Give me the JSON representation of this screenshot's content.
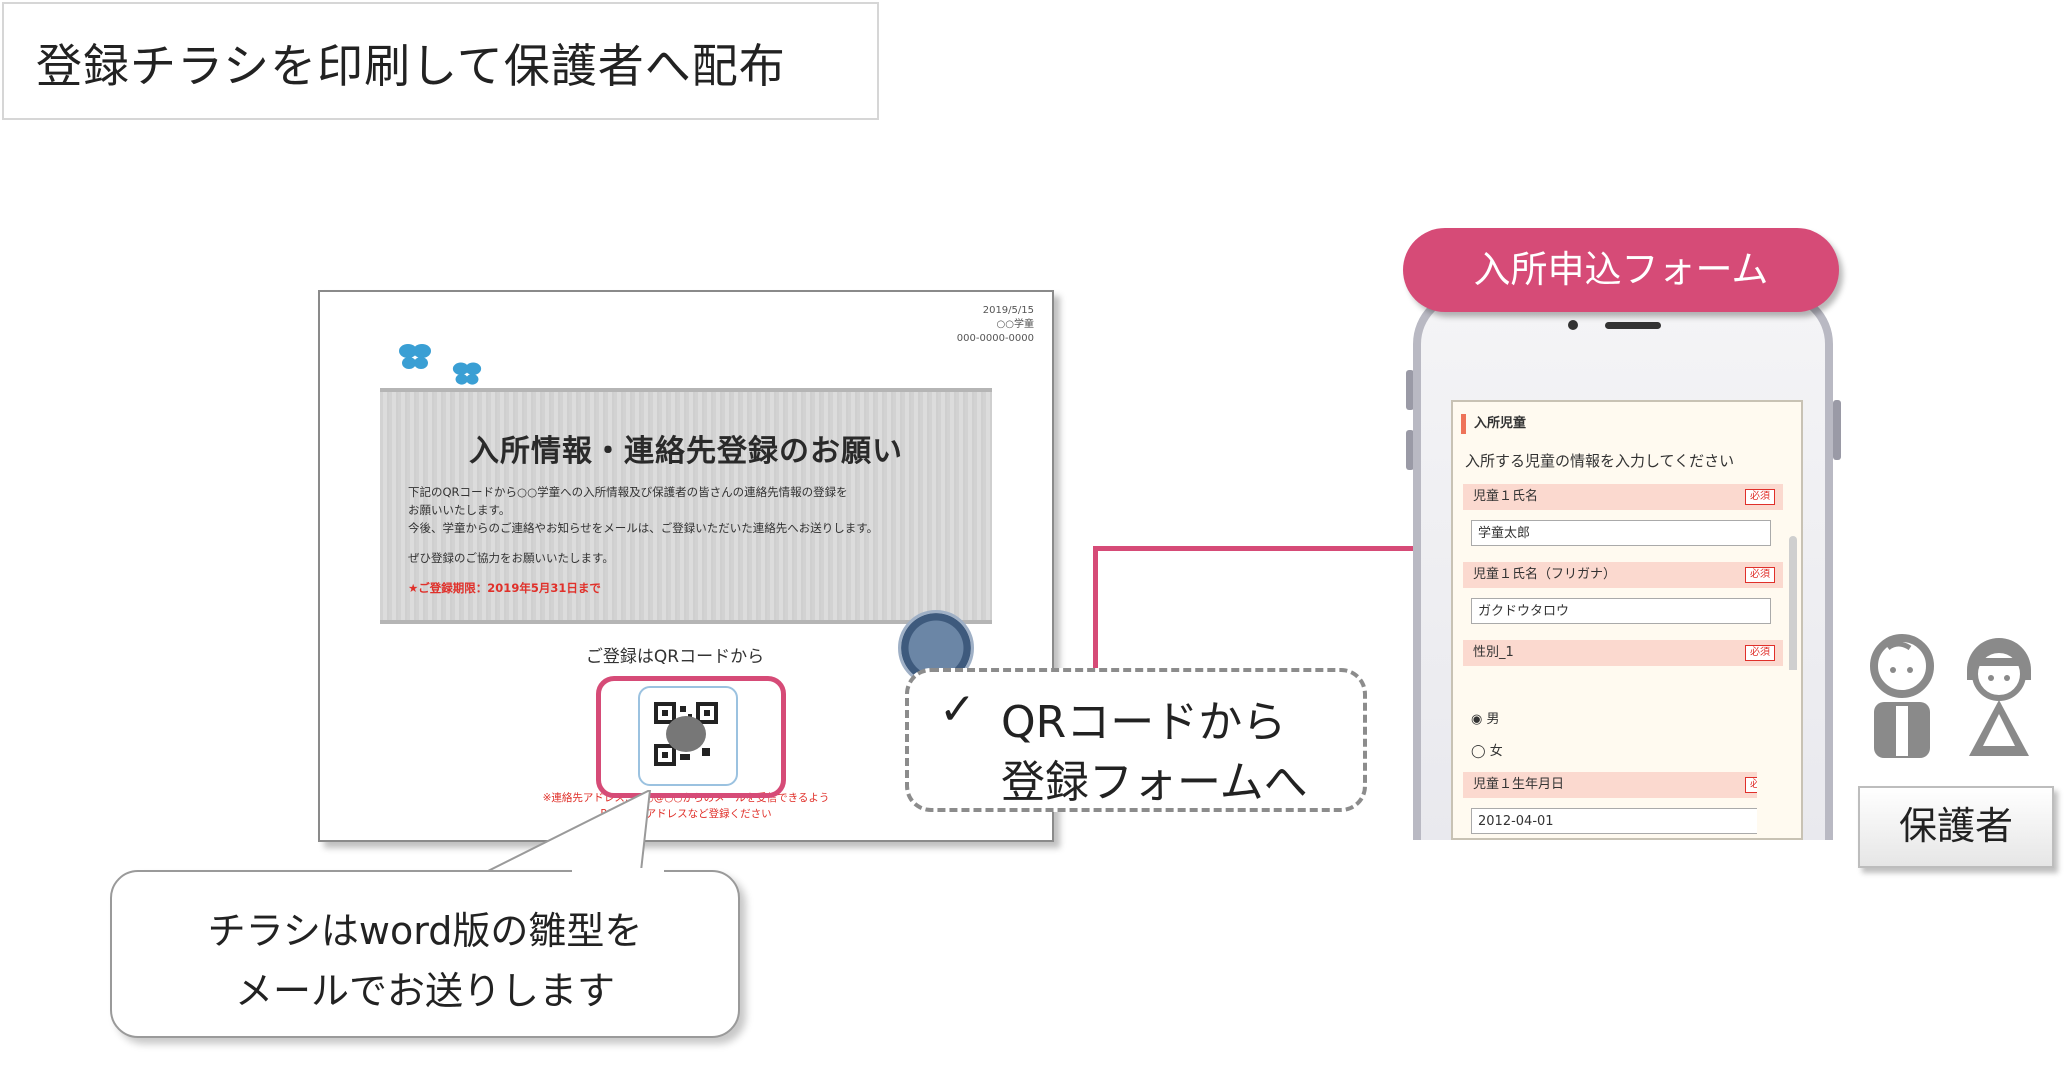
{
  "title": "登録チラシを印刷して保護者へ配布",
  "flyer": {
    "meta_lines": [
      "2019/5/15",
      "○○学童",
      "000-0000-0000"
    ],
    "heading": "入所情報・連絡先登録のお願い",
    "body_lines": [
      "下記のQRコードから○○学童への入所情報及び保護者の皆さんの連絡先情報の登録を",
      "お願いいたします。",
      "今後、学童からのご連絡やお知らせをメールは、ご登録いただいた連絡先へお送りします。",
      "ぜひ登録のご協力をお願いいたします。"
    ],
    "deadline": "★ご登録期限：2019年5月31日まで",
    "qr_caption": "ご登録はQRコードから",
    "note_lines": [
      "※連絡先アドレス…○○@○○からのメールを受信できるよう",
      "PCメールアドレスなど登録ください"
    ]
  },
  "qr_callout": {
    "check": "✓",
    "line1": "QRコードから",
    "line2": "登録フォームへ"
  },
  "speech_bubble": {
    "line1": "チラシはword版の雛型を",
    "line2": "メールでお送りします"
  },
  "form_pill": "入所申込フォーム",
  "phone_form": {
    "section_title": "入所児童",
    "instruction": "入所する児童の情報を入力してください",
    "required_badge": "必須",
    "fields": [
      {
        "label": "児童１氏名",
        "value": "学童太郎"
      },
      {
        "label": "児童１氏名（フリガナ）",
        "value": "ガクドウタロウ"
      },
      {
        "label": "性別_1",
        "value": ""
      },
      {
        "label": "児童１生年月日",
        "value": "2012-04-01"
      }
    ],
    "gender_options": [
      "男",
      "女"
    ]
  },
  "guardian_label": "保護者",
  "colors": {
    "accent_pink": "#d64b77",
    "form_label_bg": "#fbd9cf",
    "required_red": "#e0302a"
  }
}
